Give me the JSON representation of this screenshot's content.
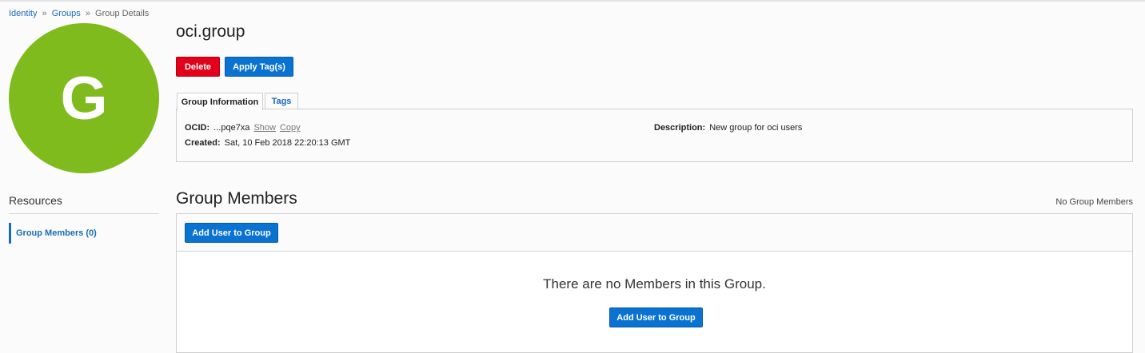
{
  "breadcrumb": {
    "items": [
      "Identity",
      "Groups",
      "Group Details"
    ],
    "separator": "»"
  },
  "avatar": {
    "letter": "G",
    "color": "#7fbb1c"
  },
  "resources": {
    "title": "Resources",
    "items": [
      {
        "label": "Group Members (0)"
      }
    ]
  },
  "group": {
    "name": "oci.group",
    "actions": {
      "delete_label": "Delete",
      "apply_tags_label": "Apply Tag(s)"
    },
    "tabs": [
      {
        "label": "Group Information"
      },
      {
        "label": "Tags"
      }
    ],
    "info": {
      "ocid_label": "OCID:",
      "ocid_value": "...pqe7xa",
      "show_label": "Show",
      "copy_label": "Copy",
      "created_label": "Created:",
      "created_value": "Sat, 10 Feb 2018 22:20:13 GMT",
      "description_label": "Description:",
      "description_value": "New group for oci users"
    }
  },
  "members": {
    "title": "Group Members",
    "status": "No Group Members",
    "add_button_label": "Add User to Group",
    "empty_message": "There are no Members in this Group.",
    "empty_add_button_label": "Add User to Group"
  },
  "colors": {
    "accent": "#0a73d1",
    "danger": "#e2001a",
    "link": "#1a6cb8"
  }
}
